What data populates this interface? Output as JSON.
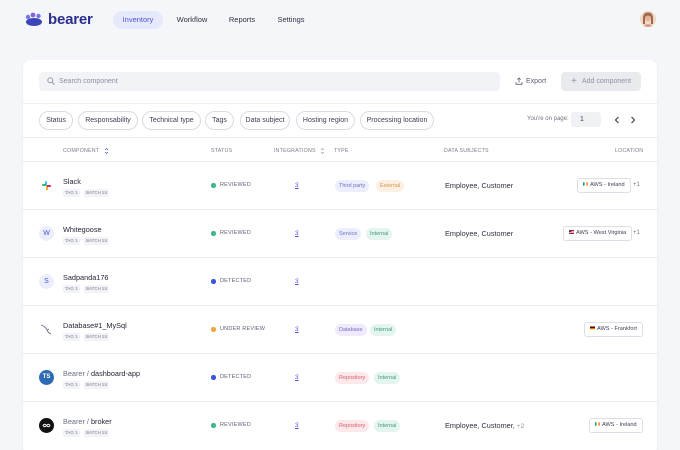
{
  "nav": {
    "logo_text": "bearer",
    "items": [
      {
        "label": "Inventory",
        "active": true
      },
      {
        "label": "Workflow",
        "active": false
      },
      {
        "label": "Reports",
        "active": false
      },
      {
        "label": "Settings",
        "active": false
      }
    ]
  },
  "toolbar": {
    "search_placeholder": "Search component",
    "export_label": "Export",
    "add_label": "Add component"
  },
  "filters": [
    "Status",
    "Responsability",
    "Technical type",
    "Tags",
    "Data subject",
    "Hosting region",
    "Processing location"
  ],
  "pagination": {
    "label": "You're on page:",
    "page": "1"
  },
  "table": {
    "headers": {
      "component": "COMPONENT",
      "status": "STATUS",
      "integrations": "INTEGRATIONS",
      "type": "TYPE",
      "subjects": "DATA SUBJECTS",
      "location": "LOCATION"
    },
    "rows": [
      {
        "icon": "slack-logo-icon",
        "namespace": "",
        "name": "Slack",
        "tags": [
          "TAG 1",
          "BATCH 24"
        ],
        "status": "REVIEWED",
        "integrations": "3",
        "types": [
          {
            "label": "Third party",
            "kind": "thirdparty"
          },
          {
            "label": "External",
            "kind": "external"
          }
        ],
        "subjects": "Employee, Customer",
        "subjects_more": "",
        "location": "AWS - Ireland",
        "location_flag": "ireland-flag-icon",
        "location_more": "+1"
      },
      {
        "icon": "whitegoose-avatar-icon",
        "icon_letter": "W",
        "namespace": "",
        "name": "Whitegoose",
        "tags": [
          "TAG 1",
          "BATCH 24"
        ],
        "status": "REVIEWED",
        "integrations": "3",
        "types": [
          {
            "label": "Service",
            "kind": "service"
          },
          {
            "label": "Internal",
            "kind": "internal"
          }
        ],
        "subjects": "Employee, Customer",
        "subjects_more": "",
        "location": "AWS - West Virginia",
        "location_flag": "usa-flag-icon",
        "location_more": "+1"
      },
      {
        "icon": "sadpanda-avatar-icon",
        "icon_letter": "S",
        "namespace": "",
        "name": "Sadpanda176",
        "tags": [
          "TAG 1",
          "BATCH 24"
        ],
        "status": "DETECTED",
        "integrations": "3",
        "types": [],
        "subjects": "",
        "subjects_more": "",
        "location": "",
        "location_flag": "",
        "location_more": ""
      },
      {
        "icon": "mysql-dolphin-icon",
        "namespace": "",
        "name": "Database#1_MySql",
        "tags": [
          "TAG 1",
          "BATCH 24"
        ],
        "status": "UNDER REVIEW",
        "integrations": "3",
        "types": [
          {
            "label": "Database",
            "kind": "database"
          },
          {
            "label": "Internal",
            "kind": "internal"
          }
        ],
        "subjects": "",
        "subjects_more": "",
        "location": "AWS - Frankfort",
        "location_flag": "germany-flag-icon",
        "location_more": ""
      },
      {
        "icon": "typescript-logo-icon",
        "icon_letter": "TS",
        "namespace": "Bearer / ",
        "name": "dashboard-app",
        "tags": [
          "TAG 1",
          "BATCH 24"
        ],
        "status": "DETECTED",
        "integrations": "3",
        "types": [
          {
            "label": "Repository",
            "kind": "repository"
          },
          {
            "label": "Internal",
            "kind": "internal"
          }
        ],
        "subjects": "",
        "subjects_more": "",
        "location": "",
        "location_flag": "",
        "location_more": ""
      },
      {
        "icon": "broker-infinity-icon",
        "namespace": "Bearer / ",
        "name": "broker",
        "tags": [
          "TAG 1",
          "BATCH 24"
        ],
        "status": "REVIEWED",
        "integrations": "3",
        "types": [
          {
            "label": "Repository",
            "kind": "repository"
          },
          {
            "label": "Internal",
            "kind": "internal"
          }
        ],
        "subjects": "Employee, Customer,",
        "subjects_more": "+2",
        "location": "AWS - Ireland",
        "location_flag": "ireland-flag-icon",
        "location_more": ""
      }
    ]
  },
  "colors": {
    "accent": "#4a54d6",
    "status_reviewed": "#3fb58f",
    "status_detected": "#3a55e0",
    "status_under_review": "#f0a83a"
  }
}
